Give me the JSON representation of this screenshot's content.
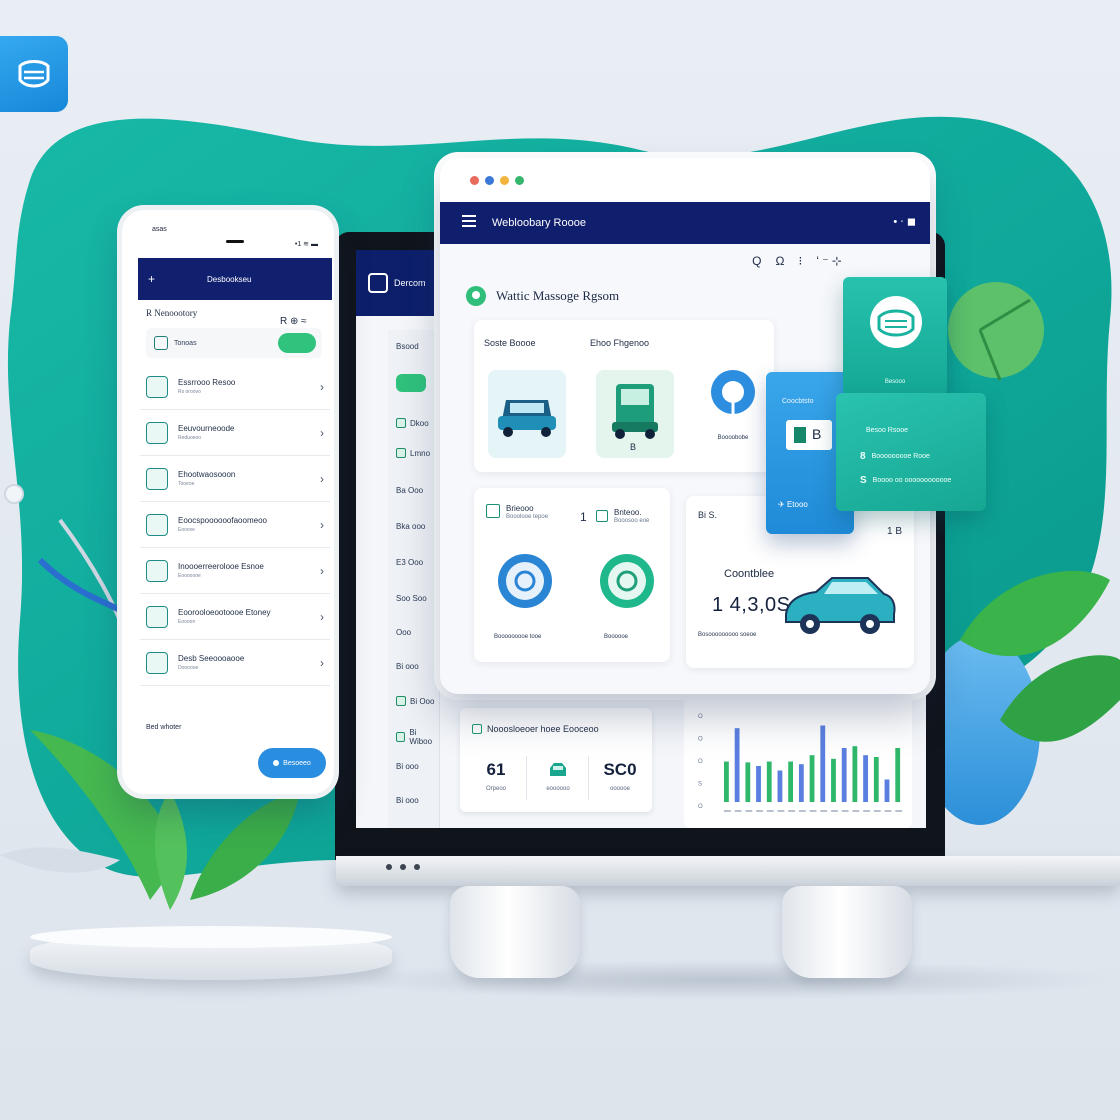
{
  "phone": {
    "status_carrier": "asas",
    "status_right": "•1 ≋ ▬",
    "nav_title": "Desbookseu",
    "section_title": "R Nenoootory",
    "section_meta": "R ⊕ ≈",
    "search_placeholder": "Tonoas",
    "search_button": "",
    "items": [
      {
        "title": "Essrrooo Resoo",
        "sub": "Rs oroovo"
      },
      {
        "title": "Eeuvourneoode",
        "sub": "Reduoeoo"
      },
      {
        "title": "Ehootwaosooon",
        "sub": "Tooeoe"
      },
      {
        "title": "Eoocspoooooofaoomeoo",
        "sub": "Eooove"
      },
      {
        "title": "Inoooerreerolooe Esnoe",
        "sub": "Eooooooe"
      },
      {
        "title": "Eoorooloeootoooe Etoney",
        "sub": "Eoooon"
      },
      {
        "title": "Desb Seeoooaooe",
        "sub": "Doooooe"
      }
    ],
    "footer_label": "Bed whoter",
    "footer_button": "Besoeeo"
  },
  "laptop": {
    "sidebar_title": "Dercom",
    "nav_items": [
      "Bsood",
      "",
      "Dkoo",
      "Lmno",
      "Ba Ooo",
      "Bka ooo",
      "E3 Ooo",
      "Soo Soo",
      "Ooo",
      "Bi ooo",
      "Bi Ooo",
      "Bi Wiboo",
      "Bi ooo",
      "Bi ooo"
    ],
    "stats_title": "Nooosloeoer hoee Eooceoo",
    "stats": [
      {
        "value": "61",
        "label": "Orpeoo"
      },
      {
        "value": "",
        "label": "eoooooo"
      },
      {
        "value": "SC0",
        "label": "oooooe"
      }
    ],
    "chart_axis": [
      "O",
      "O",
      "O",
      "S",
      "O"
    ]
  },
  "chart_data": {
    "type": "bar",
    "categories": [
      "",
      "",
      "",
      "",
      "",
      "",
      "",
      "",
      "",
      "",
      "",
      "",
      "",
      "",
      "",
      "",
      ""
    ],
    "series": [
      {
        "values": [
          0.45,
          0.82,
          0.44,
          0.4,
          0.45,
          0.35,
          0.45,
          0.42,
          0.52,
          0.85,
          0.48,
          0.6,
          0.62,
          0.52,
          0.5,
          0.25,
          0.6
        ]
      }
    ],
    "colors": [
      "#2fb86a",
      "#5a7fe0"
    ],
    "grid": false
  },
  "dashboard": {
    "nav_title": "Webloobary Roooe",
    "nav_right": "• ⋅ ◼",
    "sub_right": [
      "Q",
      "Ω",
      "⁝",
      "ʻ ⁻ ⊹"
    ],
    "heading": "Wattic Massoge Rgsom",
    "vehicle_label_left": "Soste Boooe",
    "vehicle_label_right": "Ehoo Fhgenoo",
    "vehicle_tile_caption": "B",
    "pin_caption": "Boooobobe",
    "info_left_title": "Brieooo",
    "info_left_sub": "Booolooe tepoe",
    "info_right_num": "1",
    "info_right_title": "Bnteoo.",
    "info_right_sub": "Booosoo eoe",
    "ring_caption_1": "Booooooooe tooe",
    "ring_caption_2": "Boooooe",
    "car_tag": "Bi S.",
    "car_tag_right": "1 B",
    "car_caption": "Coontblee",
    "car_value": "1 4,3,0S",
    "car_sub": "Bosooooooooo soeoe"
  },
  "cards": {
    "blue_title": "Coocbtsto",
    "blue_box": "B",
    "blue_button": "Etooo",
    "teal_caption": "Besooo",
    "teal_rows": [
      {
        "num": "",
        "text": "Besoo Rsooe"
      },
      {
        "num": "8",
        "text": "Booooooooe Rooe"
      },
      {
        "num": "S",
        "text": "Boooo oo oooooooooooe"
      }
    ]
  },
  "colors": {
    "navy": "#101e6e",
    "teal": "#19b3a0",
    "green": "#30c37e",
    "blue": "#2a8ee0"
  }
}
